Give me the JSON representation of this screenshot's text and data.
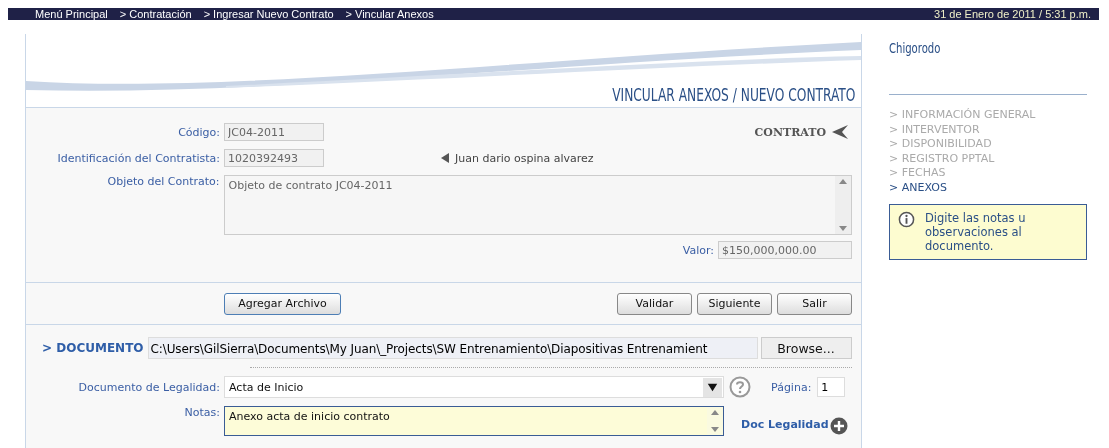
{
  "breadcrumb": [
    "Menú Principal",
    "> Contratación",
    "> Ingresar Nuevo Contrato",
    "> Vincular Anexos"
  ],
  "datetime": "31 de Enero de 2011 / 5:31 p.m.",
  "page_title": "VINCULAR ANEXOS / NUEVO CONTRATO",
  "section_tag": "CONTRATO",
  "form": {
    "codigo": {
      "label": "Código:",
      "value": "JC04-2011"
    },
    "contratista": {
      "label": "Identificación del Contratista:",
      "value": "1020392493",
      "name": "Juan dario ospina alvarez"
    },
    "objeto": {
      "label": "Objeto del Contrato:",
      "value": "Objeto de contrato JC04-2011"
    },
    "valor": {
      "label": "Valor:",
      "value": "$150,000,000.00"
    }
  },
  "buttons": {
    "add": "Agregar Archivo",
    "actions": [
      "Validar",
      "Siguiente",
      "Salir"
    ]
  },
  "documento": {
    "label": "> DOCUMENTO",
    "path": "C:\\Users\\GilSierra\\Documents\\My Juan\\_Projects\\SW Entrenamiento\\Diapositivas Entrenamient",
    "browse": "Browse..."
  },
  "legalidad": {
    "label": "Documento de Legalidad:",
    "value": "Acta de Inicio",
    "page_label": "Página:",
    "page": "1"
  },
  "notas": {
    "label": "Notas:",
    "value": "Anexo acta de inicio contrato",
    "link": "Doc Legalidad"
  },
  "sidebar": {
    "title": "Chigorodo",
    "items": [
      {
        "label": "> INFORMACIÓN GENERAL",
        "selected": false
      },
      {
        "label": "> INTERVENTOR",
        "selected": false
      },
      {
        "label": "> DISPONIBILIDAD",
        "selected": false
      },
      {
        "label": "> REGISTRO PPTAL",
        "selected": false
      },
      {
        "label": "> FECHAS",
        "selected": false
      },
      {
        "label": "> ANEXOS",
        "selected": true
      }
    ],
    "info": "Digite las notas u observaciones al documento."
  }
}
